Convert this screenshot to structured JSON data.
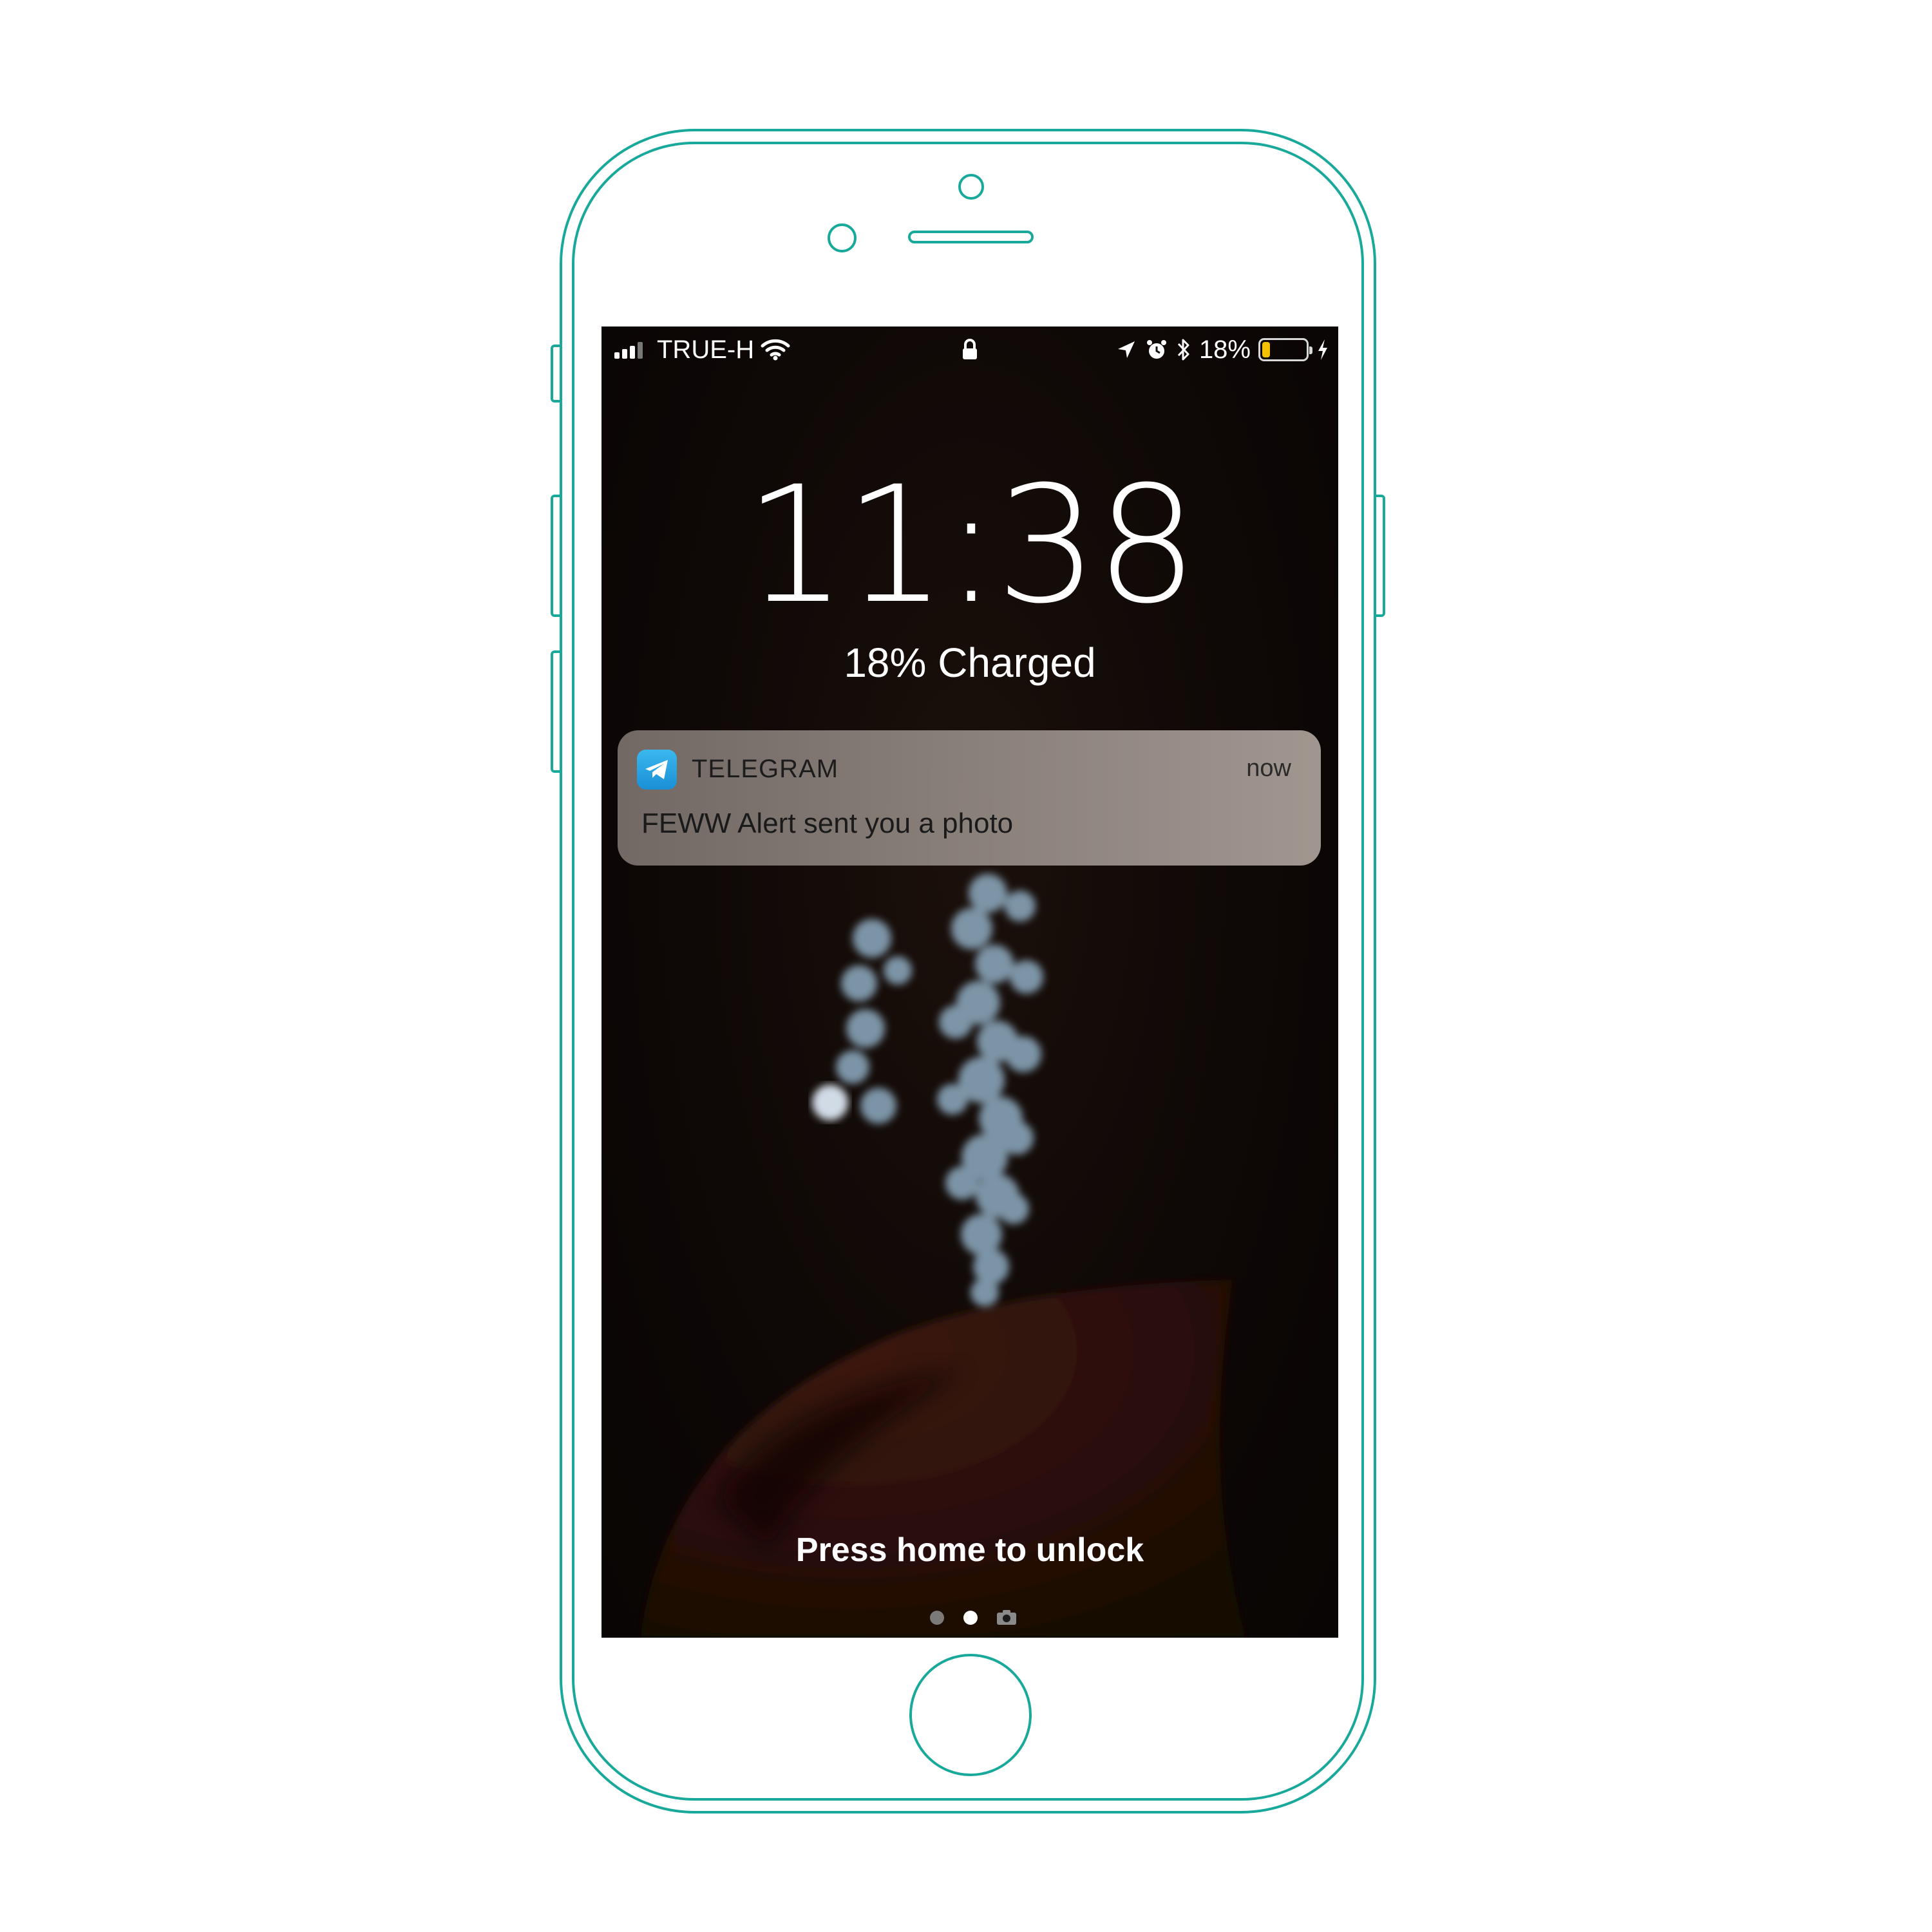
{
  "status_bar": {
    "carrier": "TRUE-H",
    "battery_percent_text": "18%",
    "battery_level": 0.18,
    "battery_fill_color": "#f2c200",
    "icons": [
      "signal-bars-icon",
      "wifi-icon",
      "lock-icon",
      "location-arrow-icon",
      "alarm-icon",
      "bluetooth-icon",
      "battery-icon",
      "charging-bolt-icon"
    ]
  },
  "lock_screen": {
    "time": "11:38",
    "charge_status": "18% Charged",
    "unlock_hint": "Press home to unlock"
  },
  "notification": {
    "app_name": "TELEGRAM",
    "time": "now",
    "message": "FEWW Alert sent you a photo",
    "icon": "telegram-icon"
  },
  "page_indicator": {
    "pages": 2,
    "current": 2,
    "extra_icon": "camera-icon"
  },
  "colors": {
    "device_outline": "#19a99a",
    "screen_background": "#0e0806"
  }
}
